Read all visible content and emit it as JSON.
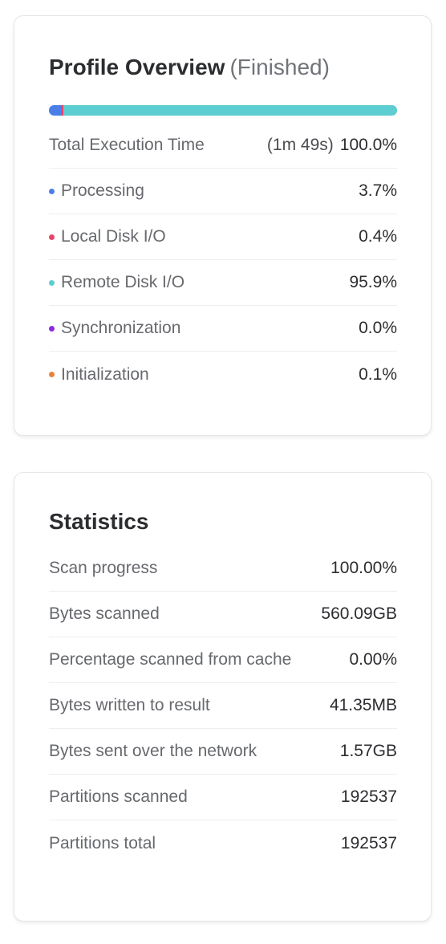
{
  "profile": {
    "title": "Profile Overview",
    "status": "(Finished)",
    "bar": [
      {
        "name": "processing",
        "percent": 3.7,
        "color": "#4a7fe8"
      },
      {
        "name": "local-disk-io",
        "percent": 0.4,
        "color": "#e8456a"
      },
      {
        "name": "remote-disk-io",
        "percent": 95.9,
        "color": "#5ccdd0"
      },
      {
        "name": "synchronization",
        "percent": 0.0,
        "color": "#8a2be2"
      },
      {
        "name": "initialization",
        "percent": 0.1,
        "color": "#e8843a"
      }
    ],
    "total": {
      "label": "Total Execution Time",
      "duration": "(1m 49s)",
      "value": "100.0%"
    },
    "rows": [
      {
        "label": "Processing",
        "value": "3.7%",
        "color": "#4a7fe8"
      },
      {
        "label": "Local Disk I/O",
        "value": "0.4%",
        "color": "#e8456a"
      },
      {
        "label": "Remote Disk I/O",
        "value": "95.9%",
        "color": "#5ccdd0"
      },
      {
        "label": "Synchronization",
        "value": "0.0%",
        "color": "#8a2be2"
      },
      {
        "label": "Initialization",
        "value": "0.1%",
        "color": "#e8843a"
      }
    ]
  },
  "statistics": {
    "title": "Statistics",
    "rows": [
      {
        "label": "Scan progress",
        "value": "100.00%"
      },
      {
        "label": "Bytes scanned",
        "value": "560.09GB"
      },
      {
        "label": "Percentage scanned from cache",
        "value": "0.00%"
      },
      {
        "label": "Bytes written to result",
        "value": "41.35MB"
      },
      {
        "label": "Bytes sent over the network",
        "value": "1.57GB"
      },
      {
        "label": "Partitions scanned",
        "value": "192537"
      },
      {
        "label": "Partitions total",
        "value": "192537"
      }
    ]
  }
}
